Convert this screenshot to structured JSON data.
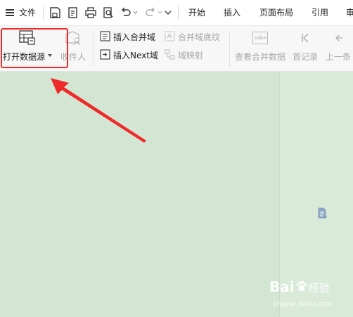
{
  "menubar": {
    "file_label": "文件",
    "tabs": [
      {
        "label": "开始"
      },
      {
        "label": "插入"
      },
      {
        "label": "页面布局"
      },
      {
        "label": "引用"
      },
      {
        "label": "审"
      }
    ]
  },
  "ribbon": {
    "open_datasource_label": "打开数据源",
    "recipients_label": "收件人",
    "insert_merge_field_label": "插入合并域",
    "insert_next_label": "插入Next域",
    "merge_field_shading_label": "合并域底纹",
    "field_mapping_label": "域映射",
    "abc_icon_text": "«ab»",
    "view_merge_data_label": "查看合并数据",
    "first_record_label": "首记录",
    "prev_record_label": "上一条"
  },
  "watermark": {
    "brand": "Bai",
    "brand_cn": "经验",
    "url": "jingyan.baidu.com"
  },
  "colors": {
    "highlight": "#ee2a2a",
    "arrow": "#ee2a2a",
    "workspace": "#d3e6d4"
  }
}
